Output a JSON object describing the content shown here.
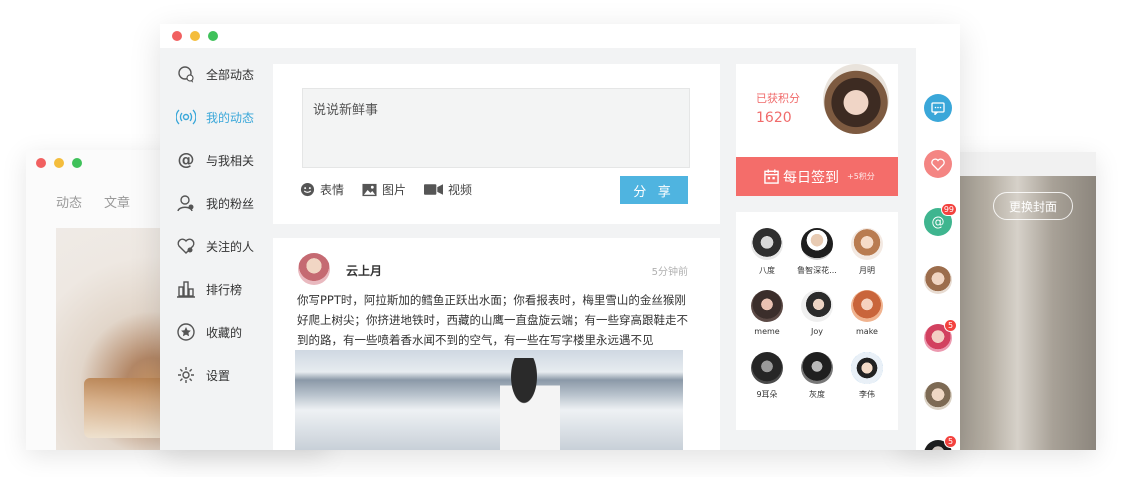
{
  "back_left": {
    "tabs": [
      "动态",
      "文章"
    ]
  },
  "back_right": {
    "cover_button": "更换封面"
  },
  "sidebar": {
    "items": [
      {
        "label": "全部动态",
        "icon": "chat-bubbles-icon"
      },
      {
        "label": "我的动态",
        "icon": "broadcast-icon",
        "active": true
      },
      {
        "label": "与我相关",
        "icon": "at-sign-icon"
      },
      {
        "label": "我的粉丝",
        "icon": "user-icon"
      },
      {
        "label": "关注的人",
        "icon": "heart-user-icon"
      },
      {
        "label": "排行榜",
        "icon": "bar-chart-icon"
      },
      {
        "label": "收藏的",
        "icon": "star-icon"
      },
      {
        "label": "设置",
        "icon": "gear-icon"
      }
    ]
  },
  "composer": {
    "placeholder": "说说新鲜事",
    "tools": [
      {
        "label": "表情",
        "icon": "smiley-icon"
      },
      {
        "label": "图片",
        "icon": "image-icon"
      },
      {
        "label": "视频",
        "icon": "video-icon"
      }
    ],
    "share_label": "分 享"
  },
  "post": {
    "author": "云上月",
    "time": "5分钟前",
    "text": "你写PPT时，阿拉斯加的鳕鱼正跃出水面；你看报表时，梅里雪山的金丝猴刚好爬上树尖；你挤进地铁时，西藏的山鹰一直盘旋云端；有一些穿高跟鞋走不到的路，有一些喷着香水闻不到的空气，有一些在写字楼里永远遇不见"
  },
  "points": {
    "label": "已获积分",
    "value": "1620",
    "checkin_label": "每日签到",
    "checkin_bonus": "+5积分"
  },
  "friends": [
    {
      "name": "八度"
    },
    {
      "name": "鲁智深花..."
    },
    {
      "name": "月明"
    },
    {
      "name": "meme"
    },
    {
      "name": "Joy"
    },
    {
      "name": "make"
    },
    {
      "name": "9耳朵"
    },
    {
      "name": "灰度"
    },
    {
      "name": "李伟"
    }
  ],
  "rail": [
    {
      "icon": "message-icon",
      "color": "#3aa7d9",
      "badge": ""
    },
    {
      "icon": "heart-icon",
      "color": "#f48583",
      "badge": ""
    },
    {
      "icon": "at-icon",
      "color": "#3fb58f",
      "badge": "99"
    },
    {
      "icon": "avatar",
      "color": "#d7b49a",
      "badge": ""
    },
    {
      "icon": "avatar",
      "color": "#e0557a",
      "badge": "5"
    },
    {
      "icon": "avatar",
      "color": "#c9b79b",
      "badge": ""
    },
    {
      "icon": "avatar",
      "color": "#333333",
      "badge": "5"
    }
  ],
  "colors": {
    "accent": "#3aa7d9",
    "share": "#4fb4e0",
    "points": "#f06b6b",
    "checkin": "#f46d6a"
  }
}
